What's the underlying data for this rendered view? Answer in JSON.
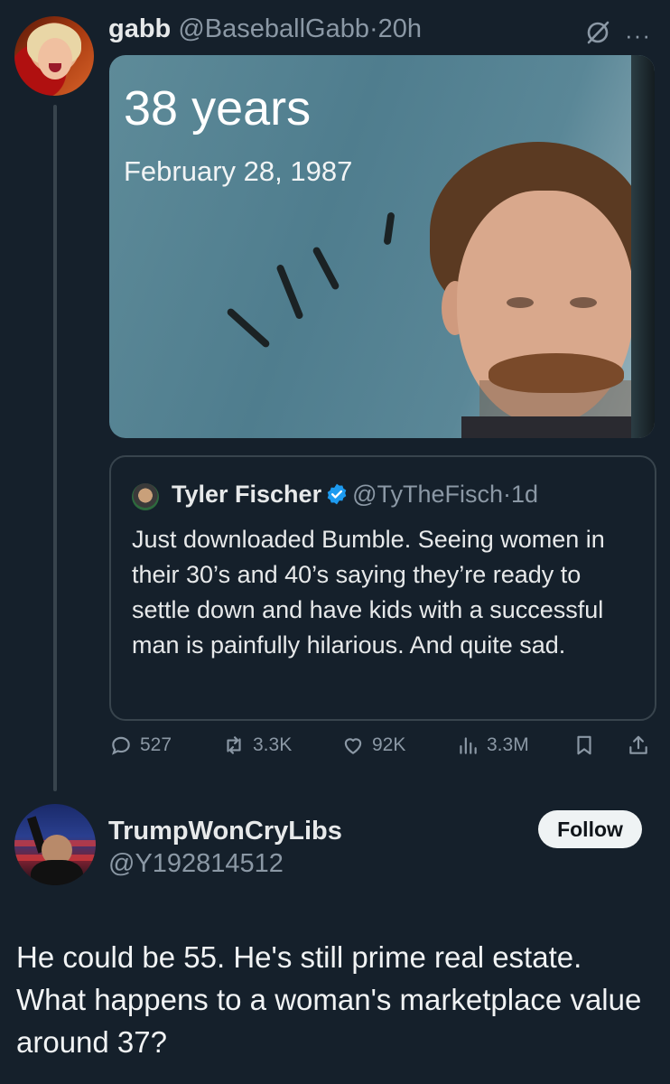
{
  "tweet1": {
    "author_name": "gabb",
    "author_handle": "@BaseballGabb",
    "time": "20h",
    "media": {
      "title": "38 years",
      "date": "February 28, 1987"
    },
    "quoted": {
      "author_name": "Tyler Fischer",
      "author_handle": "@TyTheFisch",
      "time": "1d",
      "text": "Just downloaded Bumble. Seeing women in their 30’s and 40’s saying they’re ready to settle down and have kids with a successful man is painfully hilarious. And quite sad."
    },
    "actions": {
      "replies": "527",
      "reposts": "3.3K",
      "likes": "92K",
      "views": "3.3M"
    }
  },
  "tweet2": {
    "author_name": "TrumpWonCryLibs",
    "author_handle": "@Y192814512",
    "follow_label": "Follow",
    "text": "He could be 55. He's still prime real estate. What happens to a woman's marketplace value around 37?"
  },
  "colors": {
    "background": "#15202b",
    "text": "#e7e9ea",
    "muted": "#8b98a5",
    "verified": "#1d9bf0",
    "border": "#38444d"
  },
  "icons": [
    "grok-icon",
    "more-icon",
    "verified-badge-icon",
    "reply-icon",
    "repost-icon",
    "like-icon",
    "views-icon",
    "bookmark-icon",
    "share-icon"
  ]
}
